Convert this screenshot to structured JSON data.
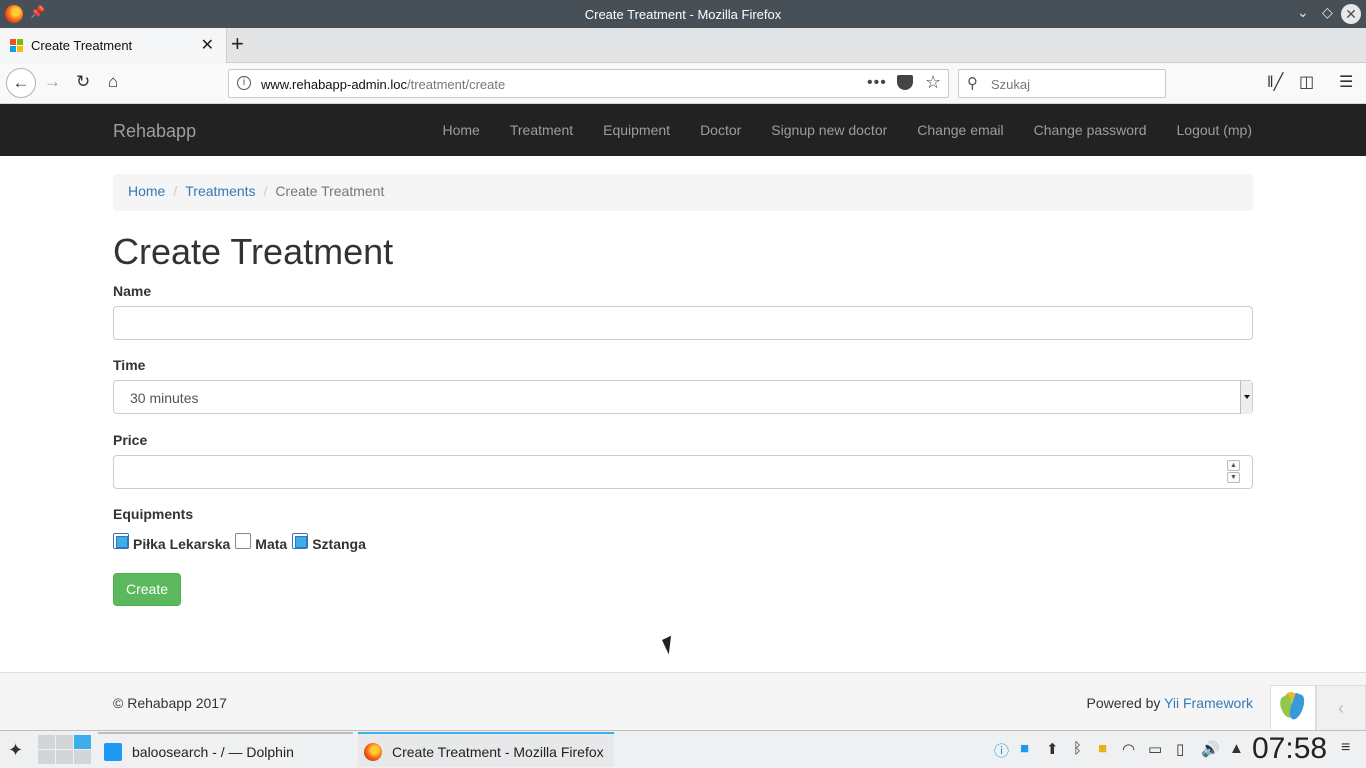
{
  "window": {
    "title": "Create Treatment - Mozilla Firefox"
  },
  "browser": {
    "tab_title": "Create Treatment",
    "url_domain": "www.rehabapp-admin.loc",
    "url_path": "/treatment/create",
    "search_placeholder": "Szukaj"
  },
  "app": {
    "brand": "Rehabapp",
    "nav": [
      "Home",
      "Treatment",
      "Equipment",
      "Doctor",
      "Signup new doctor",
      "Change email",
      "Change password",
      "Logout (mp)"
    ]
  },
  "breadcrumb": {
    "home": "Home",
    "treatments": "Treatments",
    "current": "Create Treatment"
  },
  "form": {
    "heading": "Create Treatment",
    "name_label": "Name",
    "name_value": "",
    "time_label": "Time",
    "time_value": "30 minutes",
    "price_label": "Price",
    "price_value": "",
    "equipments_label": "Equipments",
    "equipments": [
      {
        "label": "Piłka Lekarska",
        "checked": true
      },
      {
        "label": "Mata",
        "checked": false
      },
      {
        "label": "Sztanga",
        "checked": true
      }
    ],
    "submit_label": "Create"
  },
  "footer": {
    "copyright": "© Rehabapp 2017",
    "powered_prefix": "Powered by",
    "powered_link": "Yii Framework"
  },
  "taskbar": {
    "tasks": [
      "baloosearch - / — Dolphin",
      "Create Treatment - Mozilla Firefox"
    ],
    "clock": "07:58"
  },
  "colors": {
    "navbar_bg": "#222222",
    "link": "#337ab7",
    "create_button": "#5cb85c",
    "accent": "#3daee9"
  }
}
